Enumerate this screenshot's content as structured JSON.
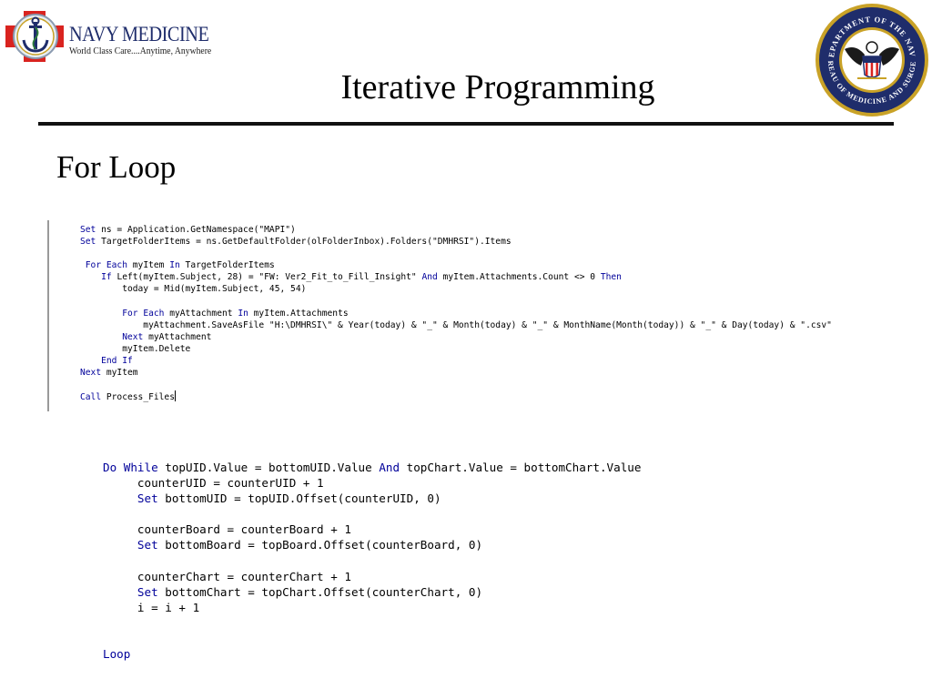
{
  "header": {
    "logo_name": "NAVY MEDICINE",
    "logo_tagline": "World Class Care....Anytime, Anywhere",
    "seal_text_top": "DEPARTMENT OF THE NAVY",
    "seal_text_bottom": "BUREAU OF MEDICINE AND SURGERY"
  },
  "slide": {
    "title": "Iterative Programming",
    "subtitle": "For Loop"
  },
  "colors": {
    "keyword": "#00009a",
    "logo_navy": "#1f2d6b",
    "logo_red": "#d9231f",
    "seal_gold": "#c9a227"
  },
  "code_block_1": [
    [
      {
        "k": 1,
        "t": "Set"
      },
      {
        "t": " ns = Application.GetNamespace(\"MAPI\")"
      }
    ],
    [
      {
        "k": 1,
        "t": "Set"
      },
      {
        "t": " TargetFolderItems = ns.GetDefaultFolder(olFolderInbox).Folders(\"DMHRSI\").Items"
      }
    ],
    [],
    [
      {
        "t": " "
      },
      {
        "k": 1,
        "t": "For Each"
      },
      {
        "t": " myItem "
      },
      {
        "k": 1,
        "t": "In"
      },
      {
        "t": " TargetFolderItems"
      }
    ],
    [
      {
        "t": "    "
      },
      {
        "k": 1,
        "t": "If"
      },
      {
        "t": " Left(myItem.Subject, 28) = \"FW: Ver2_Fit_to_Fill_Insight\" "
      },
      {
        "k": 1,
        "t": "And"
      },
      {
        "t": " myItem.Attachments.Count <> 0 "
      },
      {
        "k": 1,
        "t": "Then"
      }
    ],
    [
      {
        "t": "        today = Mid(myItem.Subject, 45, 54)"
      }
    ],
    [],
    [
      {
        "t": "        "
      },
      {
        "k": 1,
        "t": "For Each"
      },
      {
        "t": " myAttachment "
      },
      {
        "k": 1,
        "t": "In"
      },
      {
        "t": " myItem.Attachments"
      }
    ],
    [
      {
        "t": "            myAttachment.SaveAsFile \"H:\\DMHRSI\\\" & Year(today) & \"_\" & Month(today) & \"_\" & MonthName(Month(today)) & \"_\" & Day(today) & \".csv\""
      }
    ],
    [
      {
        "t": "        "
      },
      {
        "k": 1,
        "t": "Next"
      },
      {
        "t": " myAttachment"
      }
    ],
    [
      {
        "t": "        myItem.Delete"
      }
    ],
    [
      {
        "t": "    "
      },
      {
        "k": 1,
        "t": "End If"
      }
    ],
    [
      {
        "k": 1,
        "t": "Next"
      },
      {
        "t": " myItem"
      }
    ],
    [],
    [
      {
        "k": 1,
        "t": "Call"
      },
      {
        "t": " Process_Files"
      }
    ]
  ],
  "code_block_2": [
    [
      {
        "k": 1,
        "t": "Do While"
      },
      {
        "t": " topUID.Value = bottomUID.Value "
      },
      {
        "k": 1,
        "t": "And"
      },
      {
        "t": " topChart.Value = bottomChart.Value"
      }
    ],
    [
      {
        "t": "     counterUID = counterUID + 1"
      }
    ],
    [
      {
        "t": "     "
      },
      {
        "k": 1,
        "t": "Set"
      },
      {
        "t": " bottomUID = topUID.Offset(counterUID, 0)"
      }
    ],
    [],
    [
      {
        "t": "     counterBoard = counterBoard + 1"
      }
    ],
    [
      {
        "t": "     "
      },
      {
        "k": 1,
        "t": "Set"
      },
      {
        "t": " bottomBoard = topBoard.Offset(counterBoard, 0)"
      }
    ],
    [],
    [
      {
        "t": "     counterChart = counterChart + 1"
      }
    ],
    [
      {
        "t": "     "
      },
      {
        "k": 1,
        "t": "Set"
      },
      {
        "t": " bottomChart = topChart.Offset(counterChart, 0)"
      }
    ],
    [
      {
        "t": "     i = i + 1"
      }
    ],
    [],
    [],
    [
      {
        "k": 1,
        "t": "Loop"
      }
    ]
  ]
}
